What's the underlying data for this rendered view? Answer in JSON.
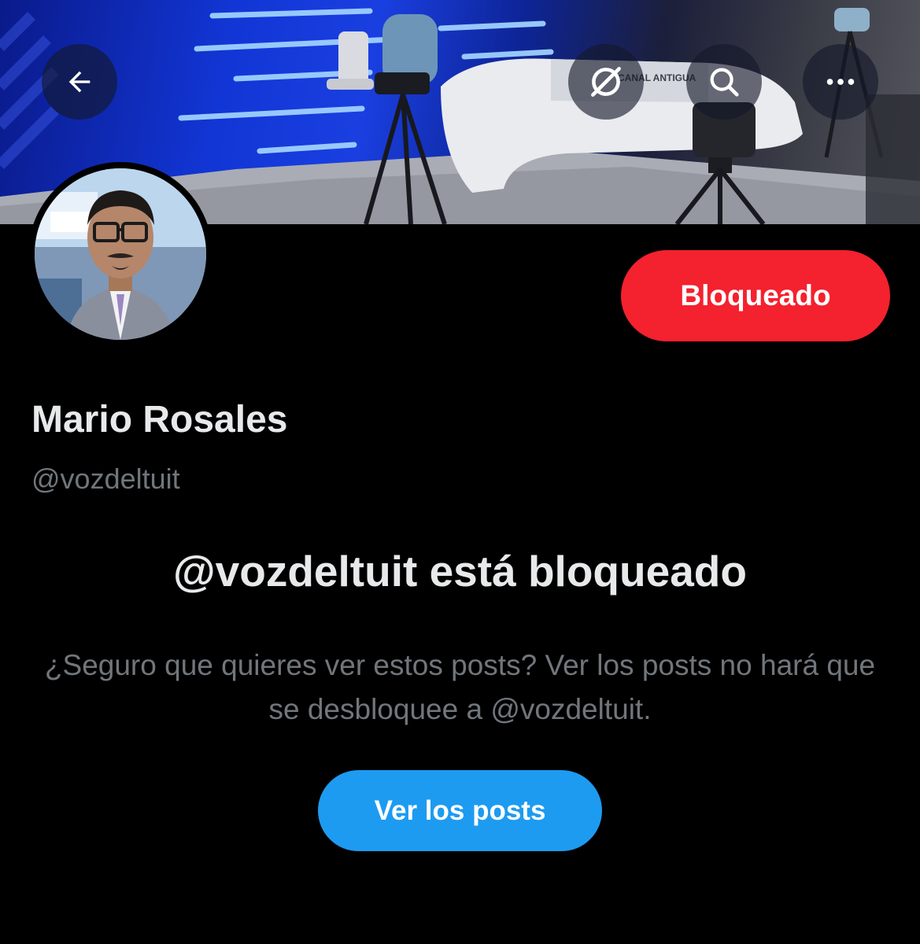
{
  "header": {
    "back_icon": "arrow-left-icon",
    "grok_icon": "grok-icon",
    "search_icon": "search-icon",
    "more_icon": "more-horizontal-icon"
  },
  "banner": {
    "studio_sign": "CANAL ANTIGUA"
  },
  "profile": {
    "display_name": "Mario Rosales",
    "handle": "@vozdeltuit",
    "block_button_label": "Bloqueado"
  },
  "blocked_notice": {
    "title": "@vozdeltuit está bloqueado",
    "description": "¿Seguro que quieres ver estos posts? Ver los posts no hará que se desbloquee a @vozdeltuit.",
    "view_button_label": "Ver los posts"
  },
  "colors": {
    "block_red": "#f4212e",
    "accent_blue": "#1d9bf0",
    "secondary_text": "#71767b",
    "primary_text": "#e7e9ea",
    "background": "#000000"
  }
}
